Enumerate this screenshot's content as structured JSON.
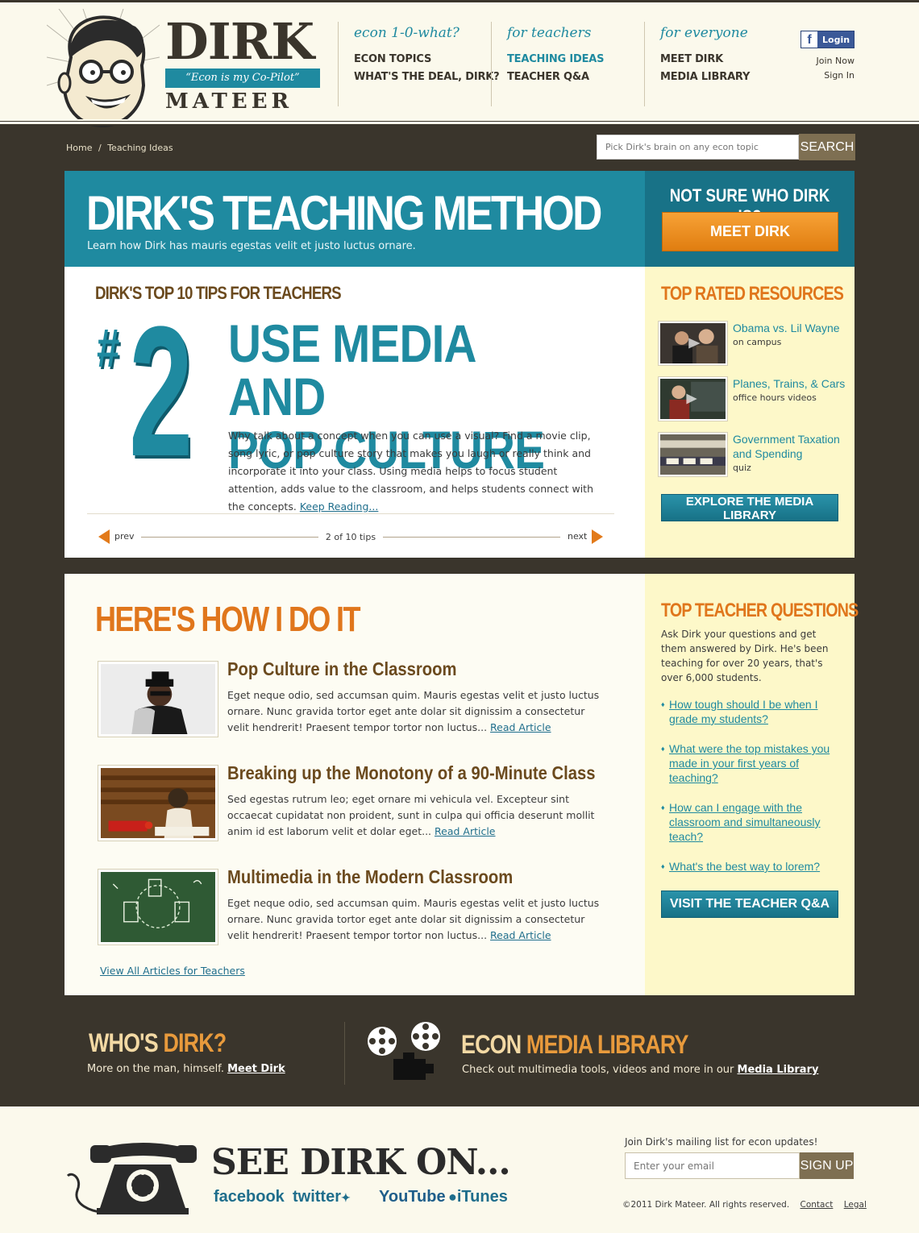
{
  "brand": {
    "name_top": "DIRK",
    "tagline": "“Econ is my Co-Pilot”",
    "name_bottom": "MATEER"
  },
  "nav": [
    {
      "heading": "econ 1-0-what?",
      "links": [
        "ECON TOPICS",
        "WHAT'S THE DEAL, DIRK?"
      ]
    },
    {
      "heading": "for teachers",
      "links": [
        "TEACHING IDEAS",
        "TEACHER Q&A"
      ]
    },
    {
      "heading": "for everyone",
      "links": [
        "MEET DIRK",
        "MEDIA LIBRARY"
      ]
    }
  ],
  "account": {
    "login": "Login",
    "join": "Join Now",
    "sign_in": "Sign In"
  },
  "breadcrumb": {
    "home": "Home",
    "separator": "/",
    "current": "Teaching Ideas"
  },
  "search": {
    "placeholder": "Pick Dirk's brain on any econ topic",
    "button": "SEARCH"
  },
  "hero": {
    "title": "DIRK'S TEACHING METHOD",
    "subtitle": "Learn how Dirk has mauris egestas velit et justo luctus ornare.",
    "side_question": "NOT SURE WHO DIRK IS?",
    "side_button": "MEET DIRK"
  },
  "tips": {
    "heading": "DIRK'S TOP 10 TIPS FOR TEACHERS",
    "hash": "#",
    "number": "2",
    "title_line1": "USE MEDIA AND",
    "title_line2": "POP CULTURE",
    "body": "Why talk about a concept when you can use a visual? Find a movie clip, song lyric, or pop culture story that makes you laugh or really think and incorporate it into your class. Using media helps to focus student attention, adds value to the classroom, and helps students connect with the concepts.",
    "read_more": "Keep Reading...",
    "prev": "prev",
    "next": "next",
    "counter": "2 of 10 tips"
  },
  "resources": {
    "heading": "TOP RATED RESOURCES",
    "items": [
      {
        "title": "Obama vs. Lil Wayne",
        "sub": "on campus"
      },
      {
        "title": "Planes, Trains, & Cars",
        "sub": "office hours videos"
      },
      {
        "title": "Government Taxation and Spending",
        "sub": "quiz"
      }
    ],
    "button": "EXPLORE THE MEDIA LIBRARY"
  },
  "howto": {
    "heading": "HERE'S HOW I DO IT",
    "articles": [
      {
        "title": "Pop Culture in the Classroom",
        "body": "Eget neque odio, sed accumsan quim. Mauris egestas velit et justo luctus ornare. Nunc gravida tortor eget ante dolar sit dignissim a consectetur velit hendrerit! Praesent tempor tortor non luctus...",
        "link": "Read Article"
      },
      {
        "title": "Breaking up the Monotony of a 90-Minute Class",
        "body": "Sed egestas rutrum leo; eget ornare mi vehicula vel. Excepteur sint occaecat cupidatat non proident, sunt in culpa qui officia deserunt mollit anim id est laborum velit et dolar eget...",
        "link": "Read Article"
      },
      {
        "title": "Multimedia in the Modern Classroom",
        "body": "Eget neque odio, sed accumsan quim. Mauris egestas velit et justo luctus ornare. Nunc gravida tortor eget ante dolar sit dignissim a consectetur velit hendrerit! Praesent tempor tortor non luctus...",
        "link": "Read Article"
      }
    ],
    "view_all": "View All Articles for Teachers"
  },
  "questions": {
    "heading": "TOP TEACHER QUESTIONS",
    "intro": "Ask Dirk your questions and get them answered by Dirk. He's been teaching for over 20 years, that's over 6,000 students.",
    "items": [
      "How tough should I be when I grade my students?",
      "What were the top mistakes you made in your first years of teaching?",
      "How can I engage with the classroom and simultaneously teach?",
      "What's the best way to lorem?"
    ],
    "button": "VISIT THE TEACHER Q&A"
  },
  "band": {
    "who_a": "WHO'S",
    "who_b": "DIRK?",
    "who_sub": "More on the man, himself.",
    "who_link": "Meet Dirk",
    "media_a": "ECON",
    "media_b": "MEDIA LIBRARY",
    "media_sub": "Check out multimedia tools, videos and more in our",
    "media_link": "Media Library"
  },
  "footer": {
    "see_dirk": "SEE DIRK ON...",
    "social": [
      "facebook",
      "twitter",
      "YouTube",
      "iTunes"
    ],
    "mailing_label": "Join Dirk's mailing list for econ updates!",
    "email_placeholder": "Enter your email",
    "signup": "SIGN UP",
    "copyright": "©2011 Dirk Mateer.  All rights reserved.",
    "contact": "Contact",
    "legal": "Legal"
  },
  "colors": {
    "teal": "#1f8aa0",
    "orange": "#e0761c",
    "brown": "#6b4a1e",
    "dark": "#3a352c",
    "cream": "#fdf8c9"
  },
  "icons": [
    "dirk-face-logo",
    "facebook-icon",
    "prev-arrow-icon",
    "next-arrow-icon",
    "film-projector-icon",
    "rotary-phone-icon",
    "twitter-bird-icon",
    "apple-icon"
  ]
}
